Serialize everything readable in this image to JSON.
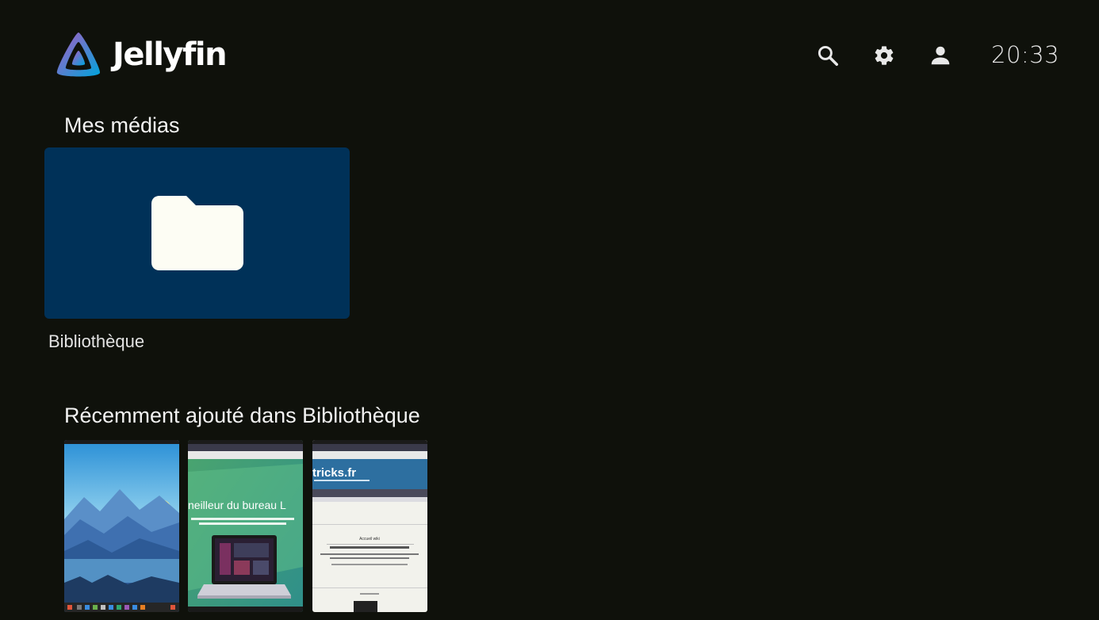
{
  "app": {
    "brand": "Jellyfin",
    "clock": "20:33"
  },
  "toolbar": {
    "icons": [
      "search-icon",
      "settings-gear-icon",
      "user-icon"
    ]
  },
  "my_media": {
    "title": "Mes médias",
    "libraries": [
      {
        "label": "Bibliothèque",
        "icon": "folder-icon",
        "color": "#003158"
      }
    ]
  },
  "recent": {
    "title": "Récemment ajouté dans Bibliothèque",
    "items": [
      {
        "kind": "screenshot-mountains-desktop"
      },
      {
        "kind": "screenshot-website-laptop",
        "text": "neilleur du bureau L"
      },
      {
        "kind": "screenshot-wiki",
        "text": "tricks.fr",
        "caption": "Accueil wiki"
      }
    ]
  },
  "colors": {
    "background": "#0f110b",
    "library_tile": "#003158",
    "brand_gradient": [
      "#aa5cc3",
      "#00a4dc"
    ]
  }
}
